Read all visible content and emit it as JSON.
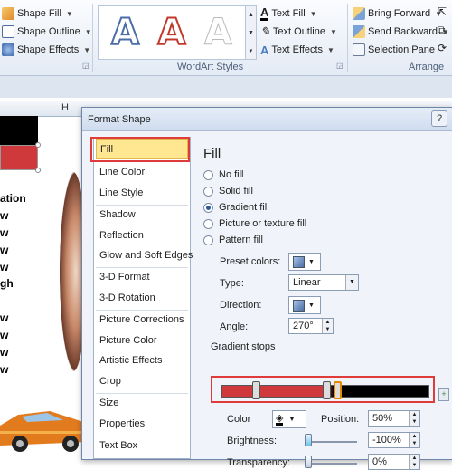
{
  "ribbon": {
    "shape_styles": {
      "shape_fill": "Shape Fill",
      "shape_outline": "Shape Outline",
      "shape_effects": "Shape Effects"
    },
    "wordart": {
      "group_label": "WordArt Styles",
      "text_fill": "Text Fill",
      "text_outline": "Text Outline",
      "text_effects": "Text Effects",
      "gallery_letter": "A"
    },
    "arrange": {
      "group_label": "Arrange",
      "bring_forward": "Bring Forward",
      "send_backward": "Send Backward",
      "selection_pane": "Selection Pane"
    }
  },
  "sheet": {
    "column_header": "H",
    "rows": [
      "ation",
      "w",
      "w",
      "w",
      "w",
      "gh",
      "w",
      "w",
      "w",
      "w"
    ]
  },
  "dialog": {
    "title": "Format Shape",
    "help": "?",
    "nav_items": [
      "Fill",
      "Line Color",
      "Line Style",
      "Shadow",
      "Reflection",
      "Glow and Soft Edges",
      "3-D Format",
      "3-D Rotation",
      "Picture Corrections",
      "Picture Color",
      "Artistic Effects",
      "Crop",
      "Size",
      "Properties",
      "Text Box"
    ],
    "selected_nav": "Fill",
    "panel": {
      "title": "Fill",
      "options": [
        "No fill",
        "Solid fill",
        "Gradient fill",
        "Picture or texture fill",
        "Pattern fill"
      ],
      "selected_option": "Gradient fill",
      "preset_colors_label": "Preset colors:",
      "type_label": "Type:",
      "type_value": "Linear",
      "direction_label": "Direction:",
      "angle_label": "Angle:",
      "angle_value": "270°",
      "gradient_stops_label": "Gradient stops",
      "color_label": "Color",
      "position_label": "Position:",
      "position_value": "50%",
      "brightness_label": "Brightness:",
      "brightness_value": "-100%",
      "transparency_label": "Transparency:",
      "transparency_value": "0%"
    }
  },
  "colors": {
    "accent_red": "#d0393b",
    "highlight_red": "#e03b3b",
    "nav_selected": "#ffe792"
  }
}
